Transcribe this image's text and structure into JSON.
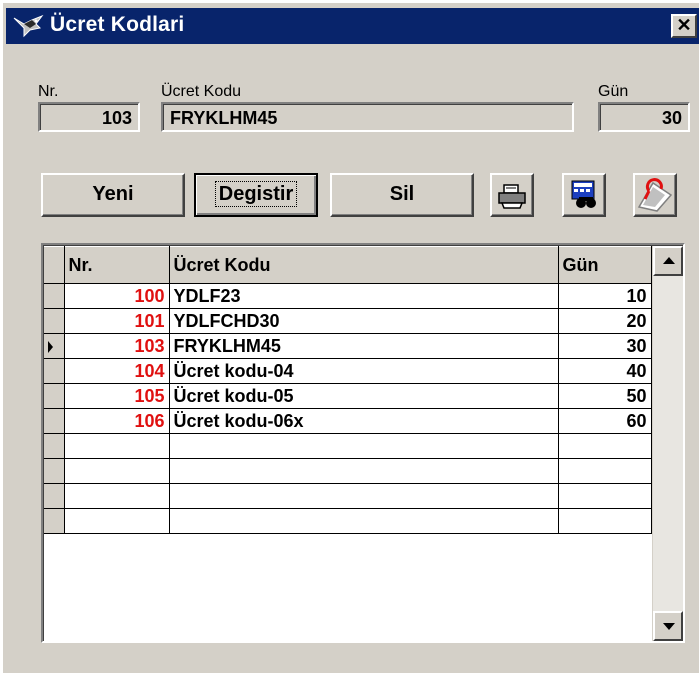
{
  "window": {
    "title": "Ücret Kodlari",
    "close_glyph": "✕",
    "title_icon": "bird-app-icon"
  },
  "form": {
    "nr_label": "Nr.",
    "nr_value": "103",
    "kod_label": "Ücret Kodu",
    "kod_value": "FRYKLHM45",
    "gun_label": "Gün",
    "gun_value": "30"
  },
  "toolbar": {
    "new_label": "Yeni",
    "edit_label": "Degistir",
    "delete_label": "Sil",
    "print_icon": "printer-icon",
    "search_icon": "binoculars-calculator-icon",
    "exit_icon": "exit-door-icon"
  },
  "grid": {
    "headers": [
      "Nr.",
      "Ücret Kodu",
      "Gün"
    ],
    "rows": [
      {
        "nr": "100",
        "kod": "YDLF23",
        "gun": "10",
        "current": false
      },
      {
        "nr": "101",
        "kod": "YDLFCHD30",
        "gun": "20",
        "current": false
      },
      {
        "nr": "103",
        "kod": "FRYKLHM45",
        "gun": "30",
        "current": true
      },
      {
        "nr": "104",
        "kod": "Ücret kodu-04",
        "gun": "40",
        "current": false
      },
      {
        "nr": "105",
        "kod": "Ücret kodu-05",
        "gun": "50",
        "current": false
      },
      {
        "nr": "106",
        "kod": "Ücret kodu-06x",
        "gun": "60",
        "current": false
      },
      {
        "nr": "",
        "kod": "",
        "gun": "",
        "current": false
      },
      {
        "nr": "",
        "kod": "",
        "gun": "",
        "current": false
      },
      {
        "nr": "",
        "kod": "",
        "gun": "",
        "current": false
      },
      {
        "nr": "",
        "kod": "",
        "gun": "",
        "current": false
      }
    ]
  },
  "colors": {
    "titlebar": "#08246b",
    "nr_text": "#e01010",
    "window_bg": "#d4d0c8"
  }
}
